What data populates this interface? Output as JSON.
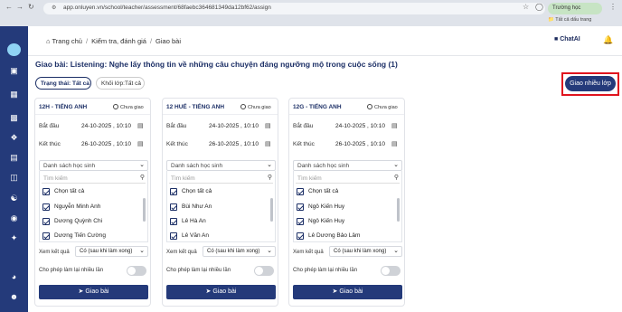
{
  "browser": {
    "url": "app.onluyen.vn/school/teacher/assessment/68faebc364681349da12bf62/assign",
    "profile_label": "Trường học",
    "bookmark_label": "Tất cả dấu trang"
  },
  "header": {
    "breadcrumb": [
      "Trang chủ",
      "Kiểm tra, đánh giá",
      "Giao bài"
    ],
    "chat_label": "ChatAI"
  },
  "page": {
    "title": "Giao bài: Listening: Nghe lấy thông tin về những câu chuyện đáng ngưỡng mộ trong cuộc sống (1)",
    "status_filter": "Trạng thái: Tất cả",
    "grade_filter": "Khối lớp:Tất cả",
    "bulk_assign_label": "Giao nhiều lớp"
  },
  "labels": {
    "not_assigned": "Chưa giao",
    "start": "Bắt đầu",
    "end": "Kết thúc",
    "student_list": "Danh sách học sinh",
    "search_placeholder": "Tìm kiếm",
    "select_all": "Chọn tất cả",
    "view_results": "Xem kết quả",
    "allow_retry": "Cho phép làm lại nhiều lần",
    "assign": "Giao bài"
  },
  "classes": [
    {
      "name": "12H - TIẾNG ANH",
      "start": "24-10-2025 , 10:10",
      "end": "26-10-2025 , 10:10",
      "students": [
        "Nguyễn Minh Anh",
        "Dương Quỳnh Chi",
        "Dương Tiến Cường"
      ],
      "view_results": "Có (sau khi làm xong)"
    },
    {
      "name": "12 HUẾ - TIẾNG ANH",
      "start": "24-10-2025 , 10:10",
      "end": "26-10-2025 , 10:10",
      "students": [
        "Bùi Như An",
        "Lê Hà An",
        "Lê Văn An"
      ],
      "view_results": "Có (sau khi làm xong)"
    },
    {
      "name": "12G - TIẾNG ANH",
      "start": "24-10-2025 , 10:10",
      "end": "26-10-2025 , 10:10",
      "students": [
        "Ngô Kiến Huy",
        "Ngô Kiến Huy",
        "Lê Dương Bảo Lâm"
      ],
      "view_results": "Có (sau khi làm xong)"
    }
  ],
  "colors": {
    "primary": "#243a7a",
    "highlight": "#e0141e"
  }
}
